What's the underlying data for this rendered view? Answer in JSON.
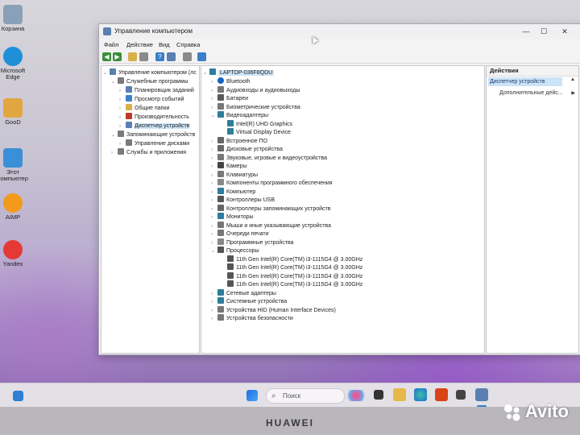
{
  "desktop": {
    "icons": [
      {
        "label": "Корзина",
        "color": "#8aa0b8"
      },
      {
        "label": "Microsoft Edge",
        "color": "#1f8fd8"
      },
      {
        "label": "GooD",
        "color": "#e2a640"
      },
      {
        "label": "Этот компьютер",
        "color": "#3a8fd8"
      },
      {
        "label": "AIMP",
        "color": "#f39a1c"
      },
      {
        "label": "Yandex",
        "color": "#e53935"
      }
    ]
  },
  "window": {
    "title": "Управление компьютером",
    "controls": {
      "minimize": "—",
      "maximize": "☐",
      "close": "✕"
    },
    "menu": [
      "Файл",
      "Действие",
      "Вид",
      "Справка"
    ]
  },
  "left_tree": [
    {
      "label": "Управление компьютером (лс",
      "level": 0,
      "icon": "computer-management-icon"
    },
    {
      "label": "Служебные программы",
      "level": 1,
      "icon": "tools-icon"
    },
    {
      "label": "Планировщик заданий",
      "level": 2,
      "icon": "scheduler-icon"
    },
    {
      "label": "Просмотр событий",
      "level": 2,
      "icon": "event-viewer-icon"
    },
    {
      "label": "Общие папки",
      "level": 2,
      "icon": "shared-folder-icon"
    },
    {
      "label": "Производительность",
      "level": 2,
      "icon": "performance-icon"
    },
    {
      "label": "Диспетчер устройств",
      "level": 2,
      "icon": "device-manager-icon",
      "selected": true
    },
    {
      "label": "Запоминающие устройств",
      "level": 1,
      "icon": "storage-icon"
    },
    {
      "label": "Управление дисками",
      "level": 2,
      "icon": "disk-icon"
    },
    {
      "label": "Службы и приложения",
      "level": 1,
      "icon": "services-icon"
    }
  ],
  "device_tree": {
    "root": "LAPTOP-036F8QDU",
    "items": [
      {
        "label": "Bluetooth",
        "level": 1,
        "expanded": false,
        "icon_color": "#1565c0"
      },
      {
        "label": "Аудиовходы и аудиовыходы",
        "level": 1,
        "expanded": false,
        "icon_color": "#777"
      },
      {
        "label": "Батареи",
        "level": 1,
        "expanded": false,
        "icon_color": "#5a5a5a"
      },
      {
        "label": "Биометрические устройства",
        "level": 1,
        "expanded": false,
        "icon_color": "#777"
      },
      {
        "label": "Видеоадаптеры",
        "level": 1,
        "expanded": true,
        "icon_color": "#2e7d9a"
      },
      {
        "label": "Intel(R) UHD Graphics",
        "level": 2,
        "icon_color": "#2e7d9a"
      },
      {
        "label": "Virtual Display Device",
        "level": 2,
        "icon_color": "#2e7d9a"
      },
      {
        "label": "Встроенное ПО",
        "level": 1,
        "expanded": false,
        "icon_color": "#666"
      },
      {
        "label": "Дисковые устройства",
        "level": 1,
        "expanded": false,
        "icon_color": "#666"
      },
      {
        "label": "Звуковые, игровые и видеоустройства",
        "level": 1,
        "expanded": false,
        "icon_color": "#777"
      },
      {
        "label": "Камеры",
        "level": 1,
        "expanded": false,
        "icon_color": "#444"
      },
      {
        "label": "Клавиатуры",
        "level": 1,
        "expanded": false,
        "icon_color": "#777"
      },
      {
        "label": "Компоненты программного обеспечения",
        "level": 1,
        "expanded": false,
        "icon_color": "#888"
      },
      {
        "label": "Компьютер",
        "level": 1,
        "expanded": false,
        "icon_color": "#2e7d9a"
      },
      {
        "label": "Контроллеры USB",
        "level": 1,
        "expanded": false,
        "icon_color": "#555"
      },
      {
        "label": "Контроллеры запоминающих устройств",
        "level": 1,
        "expanded": false,
        "icon_color": "#666"
      },
      {
        "label": "Мониторы",
        "level": 1,
        "expanded": false,
        "icon_color": "#2e7d9a"
      },
      {
        "label": "Мыши и иные указывающие устройства",
        "level": 1,
        "expanded": false,
        "icon_color": "#777"
      },
      {
        "label": "Очереди печати",
        "level": 1,
        "expanded": false,
        "icon_color": "#777"
      },
      {
        "label": "Программные устройства",
        "level": 1,
        "expanded": false,
        "icon_color": "#888"
      },
      {
        "label": "Процессоры",
        "level": 1,
        "expanded": true,
        "icon_color": "#555"
      },
      {
        "label": "11th Gen Intel(R) Core(TM) i3-1115G4 @ 3.00GHz",
        "level": 2,
        "icon_color": "#555"
      },
      {
        "label": "11th Gen Intel(R) Core(TM) i3-1115G4 @ 3.00GHz",
        "level": 2,
        "icon_color": "#555"
      },
      {
        "label": "11th Gen Intel(R) Core(TM) i3-1115G4 @ 3.00GHz",
        "level": 2,
        "icon_color": "#555"
      },
      {
        "label": "11th Gen Intel(R) Core(TM) i3-1115G4 @ 3.00GHz",
        "level": 2,
        "icon_color": "#555"
      },
      {
        "label": "Сетевые адаптеры",
        "level": 1,
        "expanded": false,
        "icon_color": "#2e7d9a"
      },
      {
        "label": "Системные устройства",
        "level": 1,
        "expanded": false,
        "icon_color": "#2e7d9a"
      },
      {
        "label": "Устройства HID (Human Interface Devices)",
        "level": 1,
        "expanded": false,
        "icon_color": "#777"
      },
      {
        "label": "Устройства безопасности",
        "level": 1,
        "expanded": false,
        "icon_color": "#777"
      }
    ]
  },
  "actions": {
    "header": "Действия",
    "section": "Диспетчер устройств",
    "more": "Дополнительные дейс..."
  },
  "taskbar": {
    "search_placeholder": "Поиск"
  },
  "bezel": {
    "brand": "HUAWEI",
    "watermark": "Avito"
  }
}
